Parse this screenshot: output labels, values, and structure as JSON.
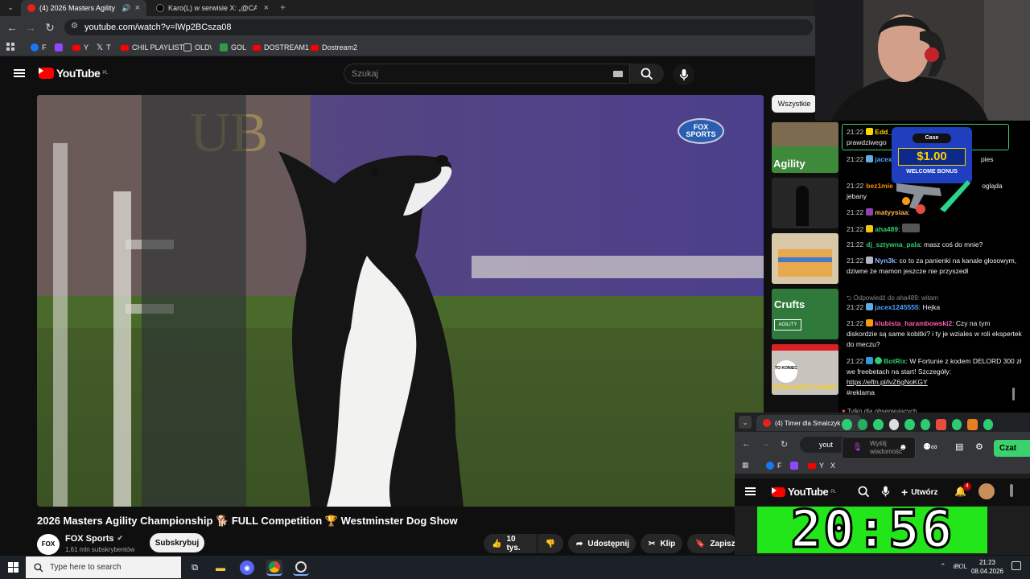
{
  "browser": {
    "tabs": [
      {
        "label": "(4) 2026 Masters Agility Ch",
        "active": true
      },
      {
        "label": "Karo(L) w serwisie X: „@CANAL",
        "active": false
      }
    ],
    "url": "youtube.com/watch?v=lWp2BCsza08",
    "bookmarks": [
      {
        "label": "F",
        "icon": "facebook-icon",
        "color": "#1877f2"
      },
      {
        "label": "",
        "icon": "twitch-icon",
        "color": "#9146ff"
      },
      {
        "label": "Y",
        "icon": "youtube-icon",
        "color": "#ff0000"
      },
      {
        "label": "T",
        "icon": "x-icon",
        "color": "#000000"
      },
      {
        "label": "CHIL PLAYLIST",
        "icon": "youtube-icon",
        "color": "#ff0000"
      },
      {
        "label": "OLD\\",
        "icon": "folder-icon",
        "color": "#bbbbbb"
      },
      {
        "label": "GOL",
        "icon": "gol-icon",
        "color": "#2a9d4a"
      },
      {
        "label": "DOSTREAM1",
        "icon": "youtube-icon",
        "color": "#ff0000"
      },
      {
        "label": "Dostream2",
        "icon": "youtube-icon",
        "color": "#ff0000"
      }
    ]
  },
  "youtube": {
    "logo_text": "YouTube",
    "region": "PL",
    "search_placeholder": "Szukaj",
    "video_title": "2026 Masters Agility Championship 🐕 FULL Competition 🏆 Westminster Dog Show",
    "channel_name": "FOX Sports",
    "subscribers": "1,61 mln subskrybentów",
    "subscribe_label": "Subskrybuj",
    "likes": "10 tys.",
    "share_label": "Udostępnij",
    "clip_label": "Klip",
    "save_label": "Zapisz",
    "filter_chip": "Wszystkie",
    "fox_watermark": "FOX SPORTS",
    "thumbs": [
      "Agility",
      "",
      "",
      "Crufts",
      "",
      ""
    ],
    "crufts_sub": "AGILITY",
    "thumb5_caption": "NITRO NISZCZY RYNEK",
    "thumb5_badge": "TO KONIEC"
  },
  "chat": {
    "messages": [
      {
        "time": "21:22",
        "user": "Edd_",
        "text": "prawdziwego",
        "color": "#ffd700"
      },
      {
        "time": "21:22",
        "user": "jacex",
        "text": "pies",
        "color": "#4ea1ff"
      },
      {
        "time": "21:22",
        "user": "bez1mie",
        "text": "ogląda jebany",
        "color": "#ff8c00"
      },
      {
        "time": "21:22",
        "user": "matyysiaa",
        "text": "",
        "color": "#ffb347"
      },
      {
        "time": "21:22",
        "user": "aha489",
        "text": "",
        "color": "#2ecc71"
      },
      {
        "time": "21:22",
        "user": "dj_sztywna_pala",
        "text": "masz coś do mnie?",
        "color": "#2ecc71"
      },
      {
        "time": "21:22",
        "user": "Nyn3k",
        "text": "co to za panienki na kanale głosowym, dziwne że mamon jeszcze nie przyszedł",
        "color": "#8ab4ff"
      },
      {
        "time": "21:22",
        "user": "jacex1245555",
        "text": "Hejka",
        "color": "#4ea1ff"
      },
      {
        "time": "21:22",
        "user": "klubista_harambowski2",
        "text": "Czy na tym diskordzie są same kobitki? i ty je wziales w roli ekspertek do meczu?",
        "color": "#ff5ab4"
      },
      {
        "time": "21:22",
        "user": "BotRix",
        "text": "W Fortunie z kodem DELORD 300 zł we freebetach na start! Szczegóły:",
        "color": "#2ecc71"
      }
    ],
    "reply_note": "Odpowiedź do aha489: witam",
    "link": "https://eftn.pl/lvZ6gNoKGY",
    "hashtag": "#reklama",
    "followers_only": "Tylko dla obserwujących",
    "input_placeholder": "Wyślij wiadomość",
    "send_label": "Czat"
  },
  "ad": {
    "brand": "Case",
    "amount": "$1.00",
    "label": "WELCOME BONUS"
  },
  "popup": {
    "tab_label": "(4) Timer dla Smalczyk",
    "url_fragment": "yout",
    "create_label": "Utwórz",
    "notif_count": "4",
    "timer": "20:56",
    "bookmarks": [
      "F",
      "",
      "Y",
      "X"
    ]
  },
  "taskbar": {
    "search_placeholder": "Type here to search",
    "language": "POL",
    "time": "21:23",
    "date": "08.04.2026"
  }
}
